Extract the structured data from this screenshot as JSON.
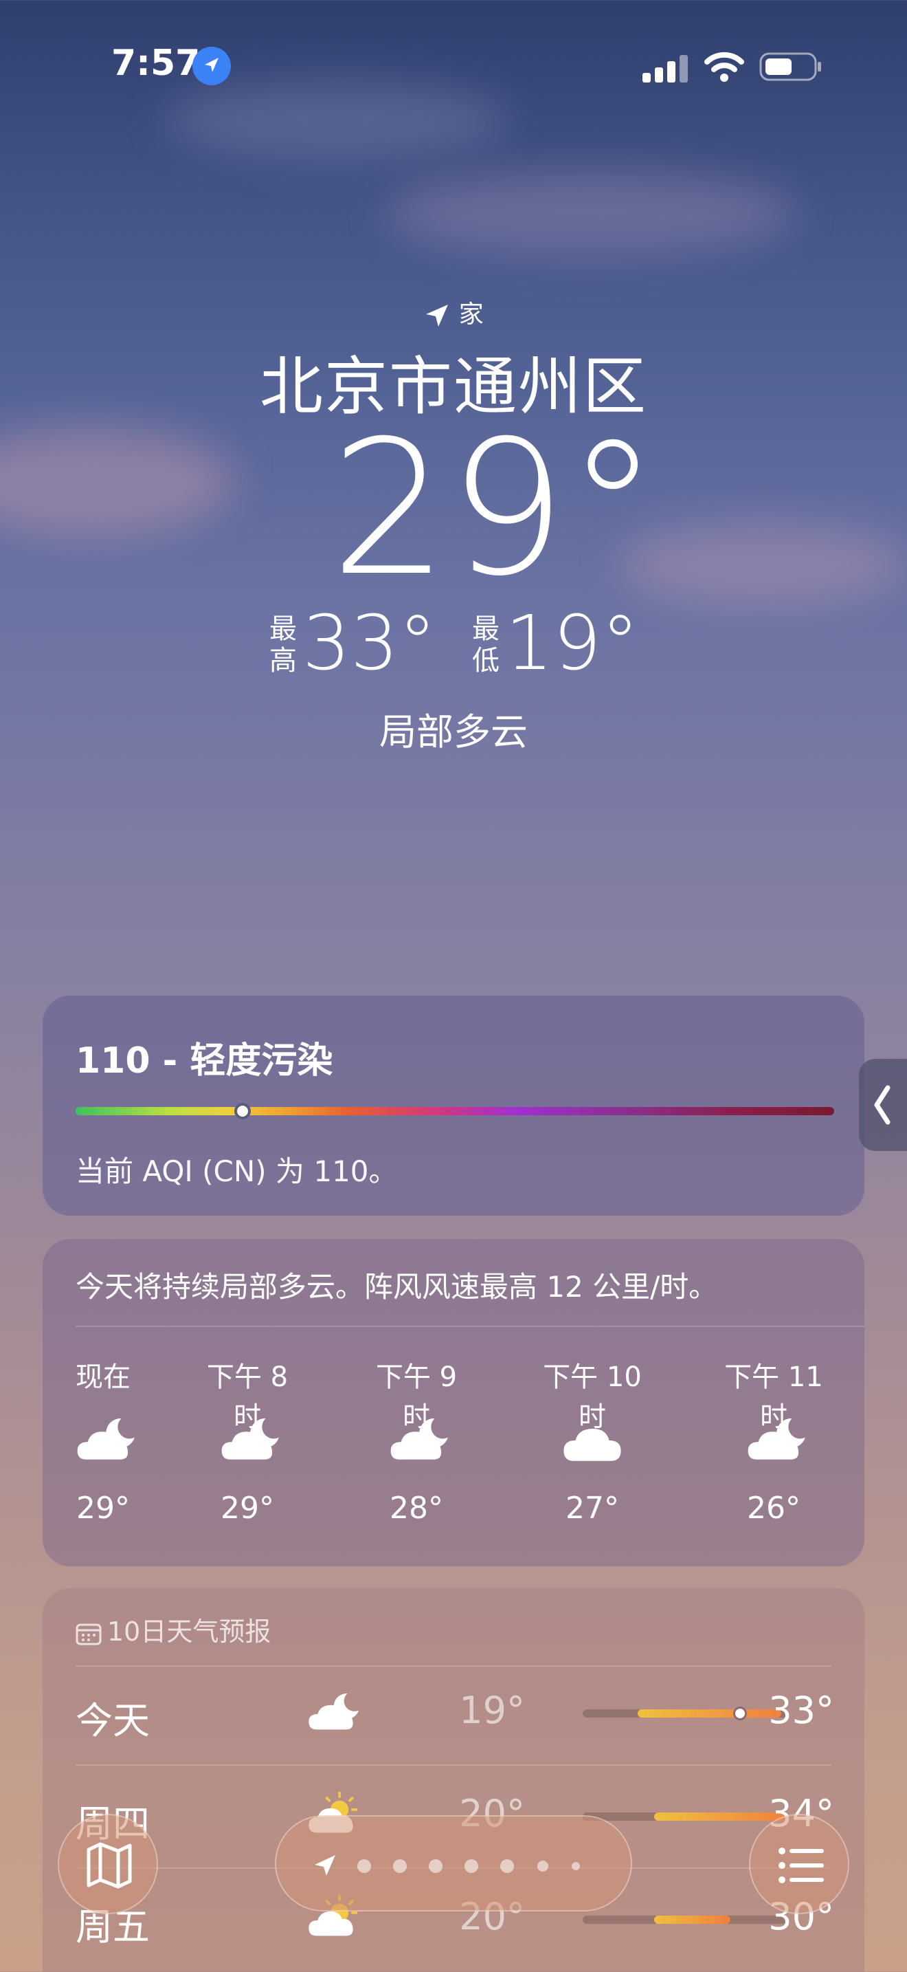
{
  "status_bar": {
    "time": "7:57"
  },
  "location": {
    "label": "家",
    "city": "北京市通州区"
  },
  "current": {
    "temp": "29°",
    "high_label": "最高",
    "high": "33°",
    "low_label": "最低",
    "low": "19°",
    "condition": "局部多云"
  },
  "aqi": {
    "title": "110 - 轻度污染",
    "description": "当前 AQI (CN) 为 110。",
    "indicator_fraction": 0.22
  },
  "hourly": {
    "summary": "今天将持续局部多云。阵风风速最高 12 公里/时。",
    "hours": [
      {
        "label": "现在",
        "icon": "partly-cloudy-night-icon",
        "temp": "29°"
      },
      {
        "label": "下午 8 时",
        "icon": "partly-cloudy-night-icon",
        "temp": "29°"
      },
      {
        "label": "下午 9 时",
        "icon": "partly-cloudy-night-icon",
        "temp": "28°"
      },
      {
        "label": "下午 10 时",
        "icon": "cloud-icon",
        "temp": "27°"
      },
      {
        "label": "下午 11 时",
        "icon": "partly-cloudy-night-icon",
        "temp": "26°"
      }
    ]
  },
  "forecast": {
    "header": "10日天气预报",
    "days": [
      {
        "day": "今天",
        "icon": "partly-cloudy-night-icon",
        "low": "19°",
        "high": "33°",
        "range_start": 0.27,
        "range_end": 0.97,
        "current_fraction": 0.77
      },
      {
        "day": "周四",
        "icon": "partly-sunny-icon",
        "low": "20°",
        "high": "34°",
        "range_start": 0.35,
        "range_end": 1.0
      },
      {
        "day": "周五",
        "icon": "partly-sunny-icon",
        "low": "20°",
        "high": "30°",
        "range_start": 0.35,
        "range_end": 0.72
      }
    ]
  },
  "colors": {
    "accent": "#3b82f6"
  }
}
